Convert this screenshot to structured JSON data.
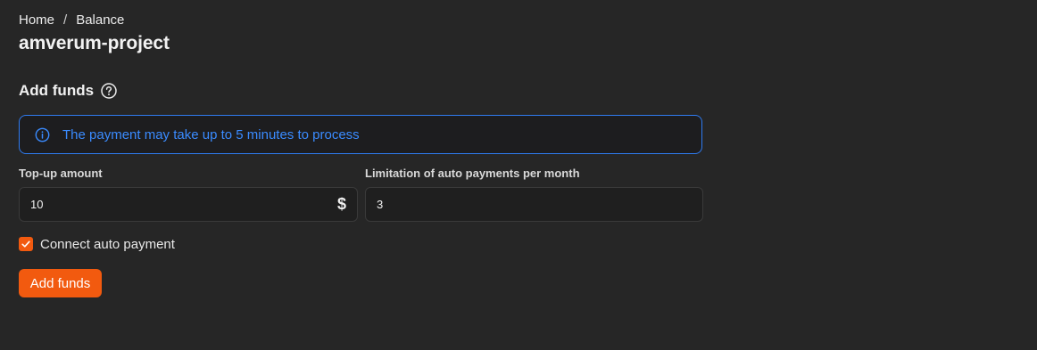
{
  "breadcrumb": {
    "home": "Home",
    "separator": "/",
    "current": "Balance"
  },
  "page_title": "amverum-project",
  "add_funds": {
    "title": "Add funds",
    "help_icon": "question-circle-icon",
    "alert": {
      "icon": "info-circle-icon",
      "text": "The payment may take up to 5 minutes to process"
    },
    "topup": {
      "label": "Top-up amount",
      "value": "10",
      "currency": "$"
    },
    "limit": {
      "label": "Limitation of auto payments per month",
      "value": "3"
    },
    "auto_payment": {
      "label": "Connect auto payment",
      "checked": true
    },
    "submit_label": "Add funds"
  },
  "colors": {
    "background": "#262626",
    "accent": "#f25a0f",
    "info": "#2f7bf0"
  }
}
